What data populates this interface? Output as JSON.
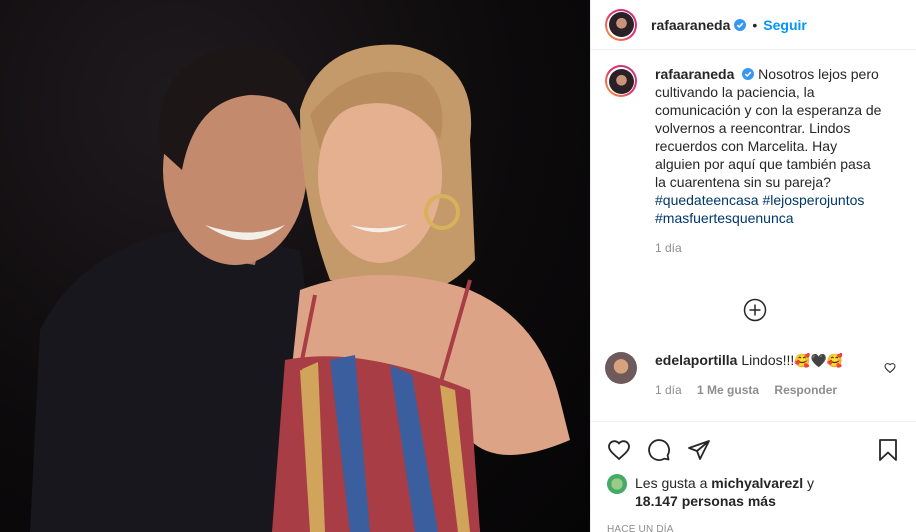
{
  "post": {
    "username": "rafaaraneda",
    "follow_label": "Seguir",
    "caption_text": "Nosotros lejos pero cultivando la paciencia, la comunicación y con la esperanza de volvernos a reencontrar. Lindos recuerdos con Marcelita. Hay alguien por aquí que también pasa la cuarentena sin su pareja?",
    "hashtags": [
      "#quedateencasa",
      "#lejosperojuntos",
      "#masfuertesquenunca"
    ],
    "caption_age": "1 día"
  },
  "comment": {
    "username": "edelaportilla",
    "text": "Lindos!!!",
    "emojis": "🥰🖤🥰",
    "age": "1 día",
    "likes": "1 Me gusta",
    "reply": "Responder"
  },
  "likes": {
    "prefix": "Les gusta a",
    "user": "michyalvarezl",
    "joiner": "y",
    "count_text": "18.147 personas más"
  },
  "timestamp": "HACE UN DÍA",
  "icons": [
    "verified-icon",
    "add-comment-icon",
    "heart-icon",
    "comment-icon",
    "share-icon",
    "bookmark-icon"
  ],
  "colors": {
    "link": "#0095f6",
    "hashtag": "#00376b",
    "muted": "#8e8e8e"
  }
}
